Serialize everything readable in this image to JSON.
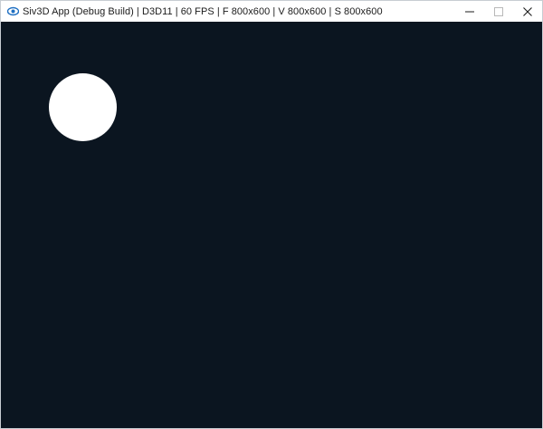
{
  "window": {
    "title": "Siv3D App (Debug Build) | D3D11 | 60 FPS | F 800x600 | V 800x600 | S 800x600",
    "icon": "siv3d-eye-icon",
    "controls": {
      "minimize_icon": "minimize-icon",
      "maximize_icon": "maximize-icon",
      "maximize_enabled": false,
      "close_icon": "close-icon"
    }
  },
  "canvas": {
    "background_color": "#0b1520",
    "shapes": [
      {
        "type": "circle",
        "color": "#ffffff"
      }
    ]
  }
}
